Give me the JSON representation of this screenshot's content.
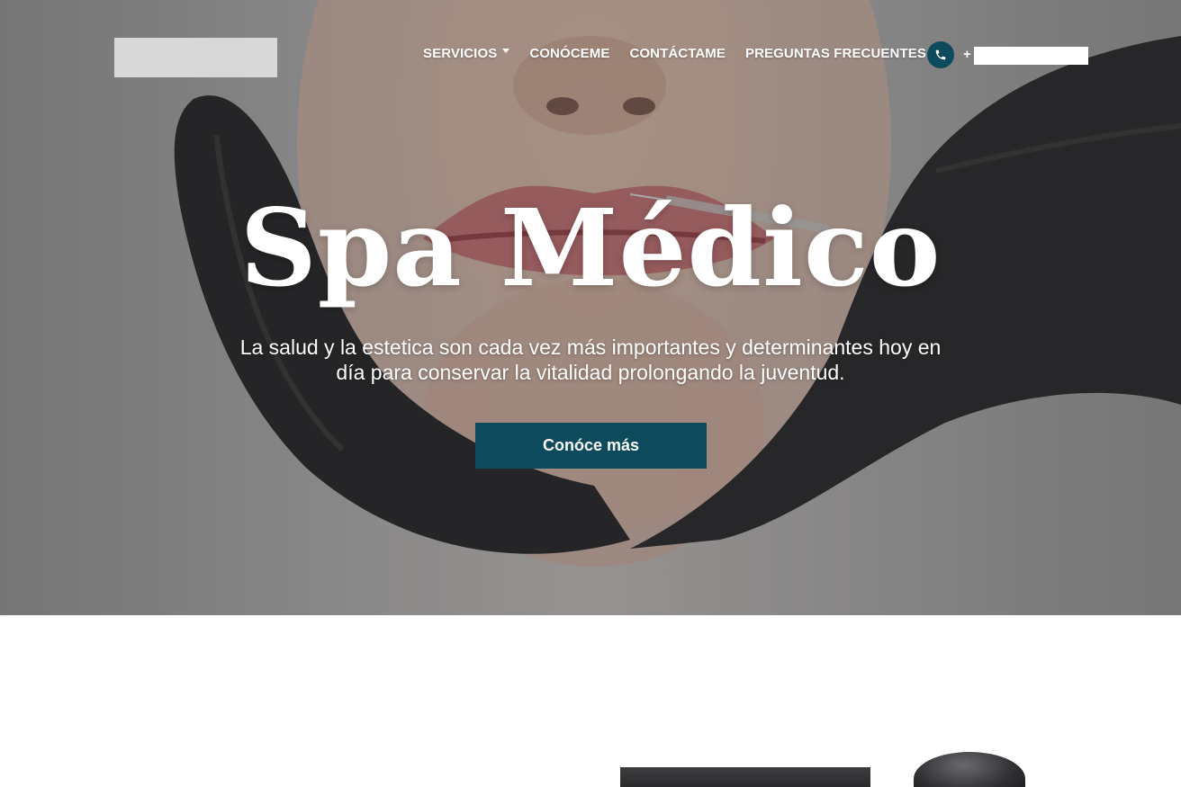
{
  "header": {
    "nav": [
      {
        "label": "SERVICIOS",
        "has_dropdown": true
      },
      {
        "label": "CONÓCEME"
      },
      {
        "label": "CONTÁCTAME"
      },
      {
        "label": "PREGUNTAS FRECUENTES"
      }
    ],
    "phone": {
      "prefix": "+",
      "icon": "phone-icon"
    }
  },
  "hero": {
    "title": "Spa Médico",
    "subtitle_line1": "La salud y la estetica son cada vez más importantes y determinantes hoy en",
    "subtitle_line2": "día para conservar la vitalidad prolongando la juventud.",
    "cta_label": "Conóce más"
  },
  "colors": {
    "accent": "#0d4a5c",
    "text_on_hero": "#ffffff",
    "background": "#ffffff"
  }
}
